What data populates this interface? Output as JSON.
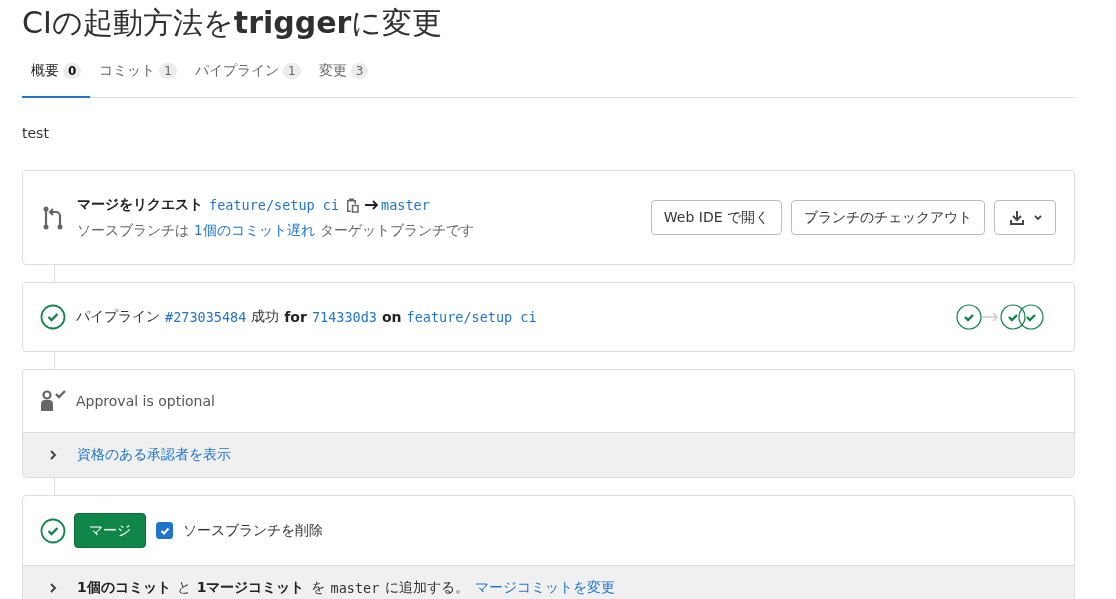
{
  "title": "CIの起動方法を**trigger**に変更",
  "tabs": [
    {
      "label": "概要",
      "count": "0",
      "selected": true
    },
    {
      "label": "コミット",
      "count": "1",
      "selected": false
    },
    {
      "label": "パイプライン",
      "count": "1",
      "selected": false
    },
    {
      "label": "変更",
      "count": "3",
      "selected": false
    }
  ],
  "description": "test",
  "merge_request": {
    "label": "マージをリクエスト",
    "source_branch": "feature/setup ci",
    "target_branch": "master",
    "status_before": "ソースブランチは",
    "status_link": "1個のコミット遅れ",
    "status_after": "ターゲットブランチです",
    "buttons": [
      "Web IDE で開く",
      "ブランチのチェックアウト"
    ]
  },
  "pipeline": {
    "label": "パイプライン",
    "id": "#273035484",
    "status": "成功",
    "for": "for",
    "commit": "714330d3",
    "on": "on",
    "branch": "feature/setup ci",
    "stages": [
      {
        "passed": true
      },
      {
        "passed": true
      },
      {
        "passed": true
      }
    ]
  },
  "approval": {
    "text": "Approval is optional",
    "expand_link": "資格のある承認者を表示"
  },
  "merge": {
    "button": "マージ",
    "delete_source": {
      "label": "ソースブランチを削除",
      "checked": true
    },
    "footer_parts": [
      {
        "kind": "bold",
        "text": "1個のコミット"
      },
      {
        "kind": "plain",
        "text": "と"
      },
      {
        "kind": "bold",
        "text": "1マージコミット"
      },
      {
        "kind": "plain",
        "text": "を"
      },
      {
        "kind": "code",
        "text": "master"
      },
      {
        "kind": "plain",
        "text": "に追加する。"
      },
      {
        "kind": "link",
        "text": "マージコミットを変更"
      }
    ]
  }
}
